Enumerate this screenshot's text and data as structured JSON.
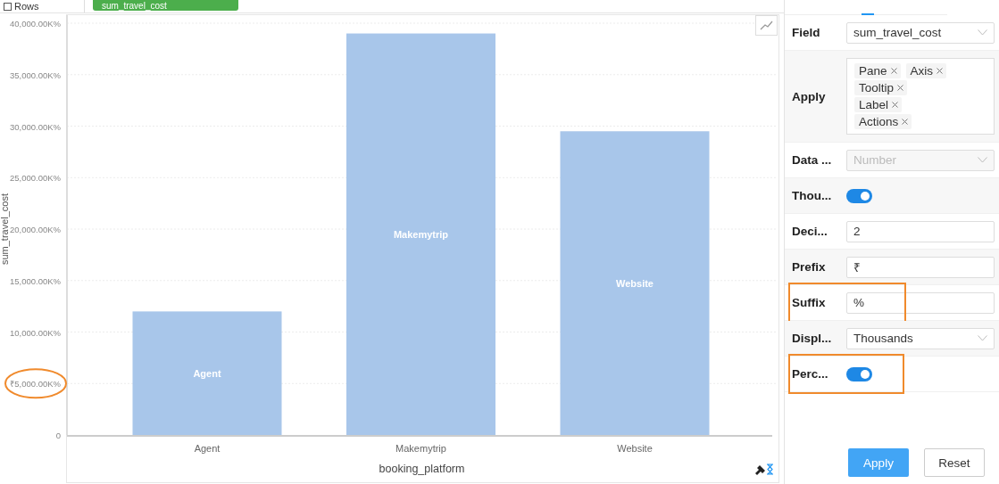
{
  "toolbar": {
    "rows_label": "Rows",
    "measure_pill": "sum_travel_cost"
  },
  "chart": {
    "chart_data": {
      "type": "bar",
      "xlabel": "booking_platform",
      "ylabel": "sum_travel_cost",
      "categories": [
        "Agent",
        "Makemytrip",
        "Website"
      ],
      "values": [
        12000,
        39000,
        29500
      ],
      "grid": true,
      "ylim": [
        0,
        40000
      ],
      "yticks": [
        {
          "value": 0,
          "label": "0"
        },
        {
          "value": 5000,
          "label": "₹5,000.00K%"
        },
        {
          "value": 10000,
          "label": "10,000.00K%"
        },
        {
          "value": 15000,
          "label": "15,000.00K%"
        },
        {
          "value": 20000,
          "label": "20,000.00K%"
        },
        {
          "value": 25000,
          "label": "25,000.00K%"
        },
        {
          "value": 30000,
          "label": "30,000.00K%"
        },
        {
          "value": 35000,
          "label": "35,000.00K%"
        },
        {
          "value": 40000,
          "label": "40,000.00K%"
        }
      ]
    },
    "bar_category_labels": true,
    "tick_label_circled": true
  },
  "format_panel": {
    "rows": [
      {
        "kind": "select",
        "label": "Field",
        "value": "sum_travel_cost",
        "disabled": false,
        "highlighted": false
      },
      {
        "kind": "tags",
        "label": "Apply",
        "tags": [
          "Pane",
          "Axis",
          "Tooltip",
          "Label",
          "Actions"
        ],
        "highlighted": false
      },
      {
        "kind": "select",
        "label": "Data ...",
        "value": "Number",
        "disabled": true,
        "highlighted": false
      },
      {
        "kind": "toggle",
        "label": "Thou...",
        "on": true,
        "highlighted": false
      },
      {
        "kind": "input",
        "label": "Deci...",
        "value": "2",
        "highlighted": false
      },
      {
        "kind": "input",
        "label": "Prefix",
        "value": "₹",
        "highlighted": false
      },
      {
        "kind": "input",
        "label": "Suffix",
        "value": "%",
        "highlighted": true
      },
      {
        "kind": "select",
        "label": "Displ...",
        "value": "Thousands",
        "disabled": false,
        "highlighted": false
      },
      {
        "kind": "toggle",
        "label": "Perc...",
        "on": true,
        "highlighted": true
      }
    ],
    "buttons": [
      {
        "label": "Apply",
        "primary": true
      },
      {
        "label": "Reset",
        "primary": false
      }
    ]
  }
}
